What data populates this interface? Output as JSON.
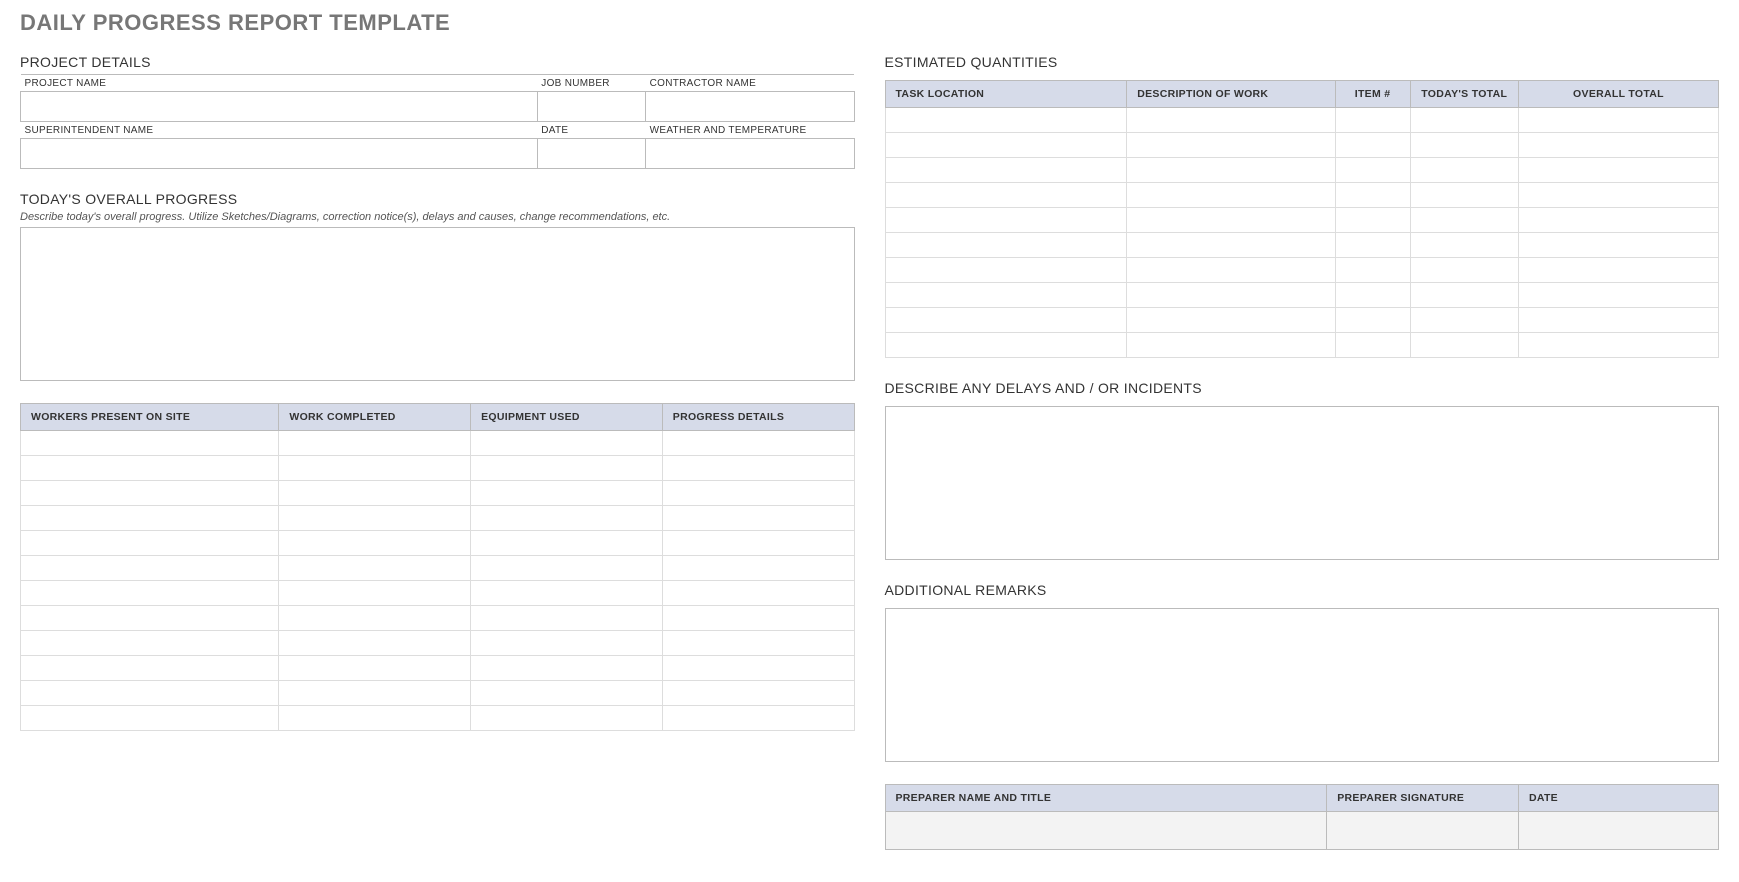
{
  "title": "DAILY PROGRESS REPORT TEMPLATE",
  "left": {
    "project_details": {
      "heading": "PROJECT DETAILS",
      "row1": {
        "project_name_label": "PROJECT NAME",
        "job_number_label": "JOB NUMBER",
        "contractor_name_label": "CONTRACTOR NAME"
      },
      "row2": {
        "superintendent_label": "SUPERINTENDENT NAME",
        "date_label": "DATE",
        "weather_label": "WEATHER AND TEMPERATURE"
      }
    },
    "overall_progress": {
      "heading": "TODAY'S OVERALL PROGRESS",
      "hint": "Describe today's overall progress.  Utilize Sketches/Diagrams, correction notice(s), delays and causes, change recommendations, etc."
    },
    "work_table": {
      "headers": [
        "WORKERS PRESENT ON SITE",
        "WORK COMPLETED",
        "EQUIPMENT USED",
        "PROGRESS DETAILS"
      ],
      "row_count": 12
    }
  },
  "right": {
    "estimated": {
      "heading": "ESTIMATED QUANTITIES",
      "headers": [
        "TASK LOCATION",
        "DESCRIPTION OF WORK",
        "ITEM #",
        "TODAY'S TOTAL",
        "OVERALL TOTAL"
      ],
      "row_count": 10
    },
    "delays": {
      "heading": "DESCRIBE ANY DELAYS AND / OR INCIDENTS"
    },
    "remarks": {
      "heading": "ADDITIONAL REMARKS"
    },
    "signoff": {
      "headers": [
        "PREPARER NAME AND TITLE",
        "PREPARER SIGNATURE",
        "DATE"
      ]
    }
  }
}
